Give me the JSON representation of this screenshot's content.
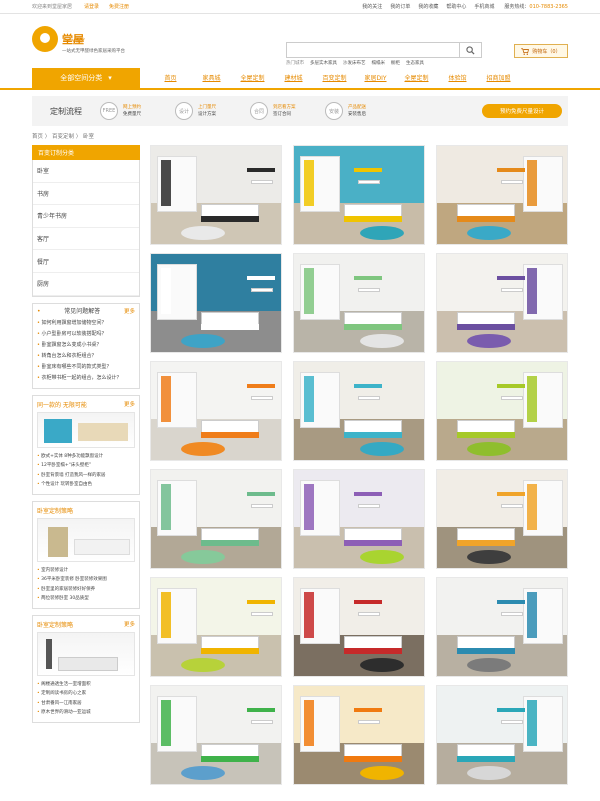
{
  "topbar": {
    "welcome": "欢迎来到堂屋家居",
    "login": "请登录",
    "register": "免费注册",
    "links": [
      "我的关注",
      "我的订单",
      "我的收藏",
      "帮助中心",
      "手机商城"
    ],
    "hotline_label": "服务热线：",
    "hotline": "010-7883-2365"
  },
  "header": {
    "logo_name": "堂屋",
    "logo_en": "Tonworld",
    "slogan": "一站式无甲醛绿色家居采购平台",
    "search_placeholder": "",
    "hot_label": "热门城市",
    "hot_words": [
      "多层实木家具",
      "沙发床布艺",
      "榻榻米",
      "橱柜",
      "生态家具"
    ],
    "cart_label": "购物车（0）"
  },
  "nav": {
    "category_label": "全部空间分类",
    "items": [
      "首页",
      "家具城",
      "全屋定制",
      "建材城",
      "百变定制",
      "家居DIY",
      "全屋定制",
      "体验馆",
      "招商加盟"
    ]
  },
  "process": {
    "title": "定制流程",
    "steps": [
      {
        "icon": "FREE",
        "a": "网上预约",
        "b": "免费量尺"
      },
      {
        "icon": "设计",
        "a": "上门量尺",
        "b": "设计方案"
      },
      {
        "icon": "合同",
        "a": "到店看方案",
        "b": "签订合同"
      },
      {
        "icon": "安装",
        "a": "产品配送",
        "b": "安装售后"
      }
    ],
    "book_label": "预约免费尺量设计"
  },
  "breadcrumb": "首页 〉 百变定制 〉 卧室",
  "sidebar": {
    "cat_title": "百变订制分类",
    "categories": [
      "卧室",
      "书房",
      "青少年书房",
      "客厅",
      "餐厅",
      "厨房"
    ],
    "faq_title": "常见问题解答",
    "more": "更多",
    "faq": [
      "如何利用飘窗增加储物空间？",
      "小户型卧房可以软装搭配吗？",
      "卧室飘窗怎么变成小书桌？",
      "转角台怎么和衣柜组合？",
      "卧室床有哪些不同的款式类型？",
      "衣柜带书柜一起的组合，怎么设计？"
    ],
    "box1_title": "同一款的 无限可能",
    "box1_items": [
      "欧式+实体 8种多功能飘窗设计",
      "12平卧室榻+“床头壁柜”",
      "卧室背景墙 打造我风一样的家居",
      "个性设计 玩转卧室自由色"
    ],
    "box2_title": "卧室定制策略",
    "box2_items": [
      "室内装修设计",
      "36平米卧室装修 卧室装修效果图",
      "卧室里的家居装修好好保养",
      "两位装修卧室 30品质型"
    ],
    "box3_title": "卧室定制策略",
    "box3_items": [
      "阁楼通透生活一室增面积",
      "定制阅读书房的心之家",
      "甘肃番风一江南家居",
      "原木世界的滑动一亚运城"
    ]
  },
  "gallery": [
    {
      "wall": "#ecebe8",
      "floor": "#cfc6b5",
      "accent": "#2a2a2a",
      "rug": "#e9e9e9"
    },
    {
      "wall": "#4ab0c6",
      "floor": "#c8bca8",
      "accent": "#f0c400",
      "rug": "#2fa5b8"
    },
    {
      "wall": "#efeae2",
      "floor": "#bfa780",
      "accent": "#e58a1a",
      "rug": "#3aa9c7"
    },
    {
      "wall": "#2f7fa0",
      "floor": "#8d8d8d",
      "accent": "#ffffff",
      "rug": "#3ea3c6"
    },
    {
      "wall": "#f1f1ef",
      "floor": "#b9b4a8",
      "accent": "#7fc67f",
      "rug": "#e4e4e4"
    },
    {
      "wall": "#f3f2ee",
      "floor": "#cbbfae",
      "accent": "#6b4fa0",
      "rug": "#7a5cae"
    },
    {
      "wall": "#f4f4f2",
      "floor": "#d9d5cd",
      "accent": "#ef7d1a",
      "rug": "#f08a23"
    },
    {
      "wall": "#f0eee8",
      "floor": "#a89a82",
      "accent": "#3db3c9",
      "rug": "#35a9c3"
    },
    {
      "wall": "#eef3e4",
      "floor": "#b9a98c",
      "accent": "#a6c928",
      "rug": "#8fbe2d"
    },
    {
      "wall": "#f2f2ef",
      "floor": "#b2a896",
      "accent": "#6dbb8c",
      "rug": "#86c99a"
    },
    {
      "wall": "#eceaf0",
      "floor": "#c9bfae",
      "accent": "#8d5fb6",
      "rug": "#a9d430"
    },
    {
      "wall": "#f1ede6",
      "floor": "#9f937e",
      "accent": "#f0a42a",
      "rug": "#3e3e3e"
    },
    {
      "wall": "#f3f5e8",
      "floor": "#c9c1ae",
      "accent": "#f0b400",
      "rug": "#b7d23a"
    },
    {
      "wall": "#f1eee8",
      "floor": "#7b6f61",
      "accent": "#c62a2a",
      "rug": "#2d2d2d"
    },
    {
      "wall": "#f2f2f0",
      "floor": "#b8b0a2",
      "accent": "#2c8bb0",
      "rug": "#7b7b7b"
    },
    {
      "wall": "#f2f2f0",
      "floor": "#c7c3b9",
      "accent": "#3fb24a",
      "rug": "#5c9fcc"
    },
    {
      "wall": "#f6e9c8",
      "floor": "#9b8a70",
      "accent": "#f07a10",
      "rug": "#f0b400"
    },
    {
      "wall": "#eef2f2",
      "floor": "#b6ad9e",
      "accent": "#2aa7b8",
      "rug": "#d7d7d7"
    }
  ]
}
